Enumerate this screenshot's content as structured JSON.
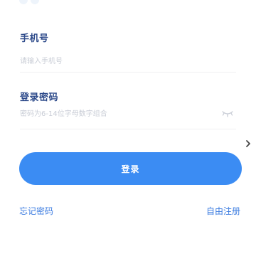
{
  "login_form": {
    "phone": {
      "label": "手机号",
      "placeholder": "请输入手机号",
      "value": ""
    },
    "password": {
      "label": "登录密码",
      "placeholder": "密码为6-14位字母数字组合",
      "value": ""
    },
    "submit_label": "登录"
  },
  "links": {
    "forgot_password": "忘记密码",
    "free_register": "自由注册"
  },
  "icons": {
    "password_visibility": "eye-closed-icon",
    "side_arrow": "chevron-right-icon"
  },
  "colors": {
    "primary": "#3b8cf3",
    "label": "#2d4a8a",
    "link": "#3a7be0",
    "placeholder": "#c9cdd6",
    "divider": "#f0f0f2"
  }
}
